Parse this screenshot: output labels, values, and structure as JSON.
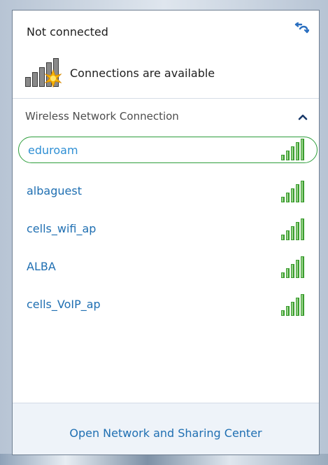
{
  "status": {
    "title": "Not connected",
    "message": "Connections are available",
    "icon": "network-unavailable-star-icon",
    "refresh_icon": "refresh-icon"
  },
  "section": {
    "title": "Wireless Network Connection",
    "collapse_icon": "chevron-up-icon"
  },
  "networks": [
    {
      "name": "eduroam",
      "signal": "excellent",
      "selected": true
    },
    {
      "name": "albaguest",
      "signal": "excellent",
      "selected": false
    },
    {
      "name": "cells_wifi_ap",
      "signal": "excellent",
      "selected": false
    },
    {
      "name": "ALBA",
      "signal": "excellent",
      "selected": false
    },
    {
      "name": "cells_VoIP_ap",
      "signal": "excellent",
      "selected": false
    }
  ],
  "footer": {
    "link_label": "Open Network and Sharing Center"
  },
  "colors": {
    "link": "#1f6fb2",
    "selected_outline": "#2e9e3c",
    "signal_green": "#3b9c2f"
  }
}
